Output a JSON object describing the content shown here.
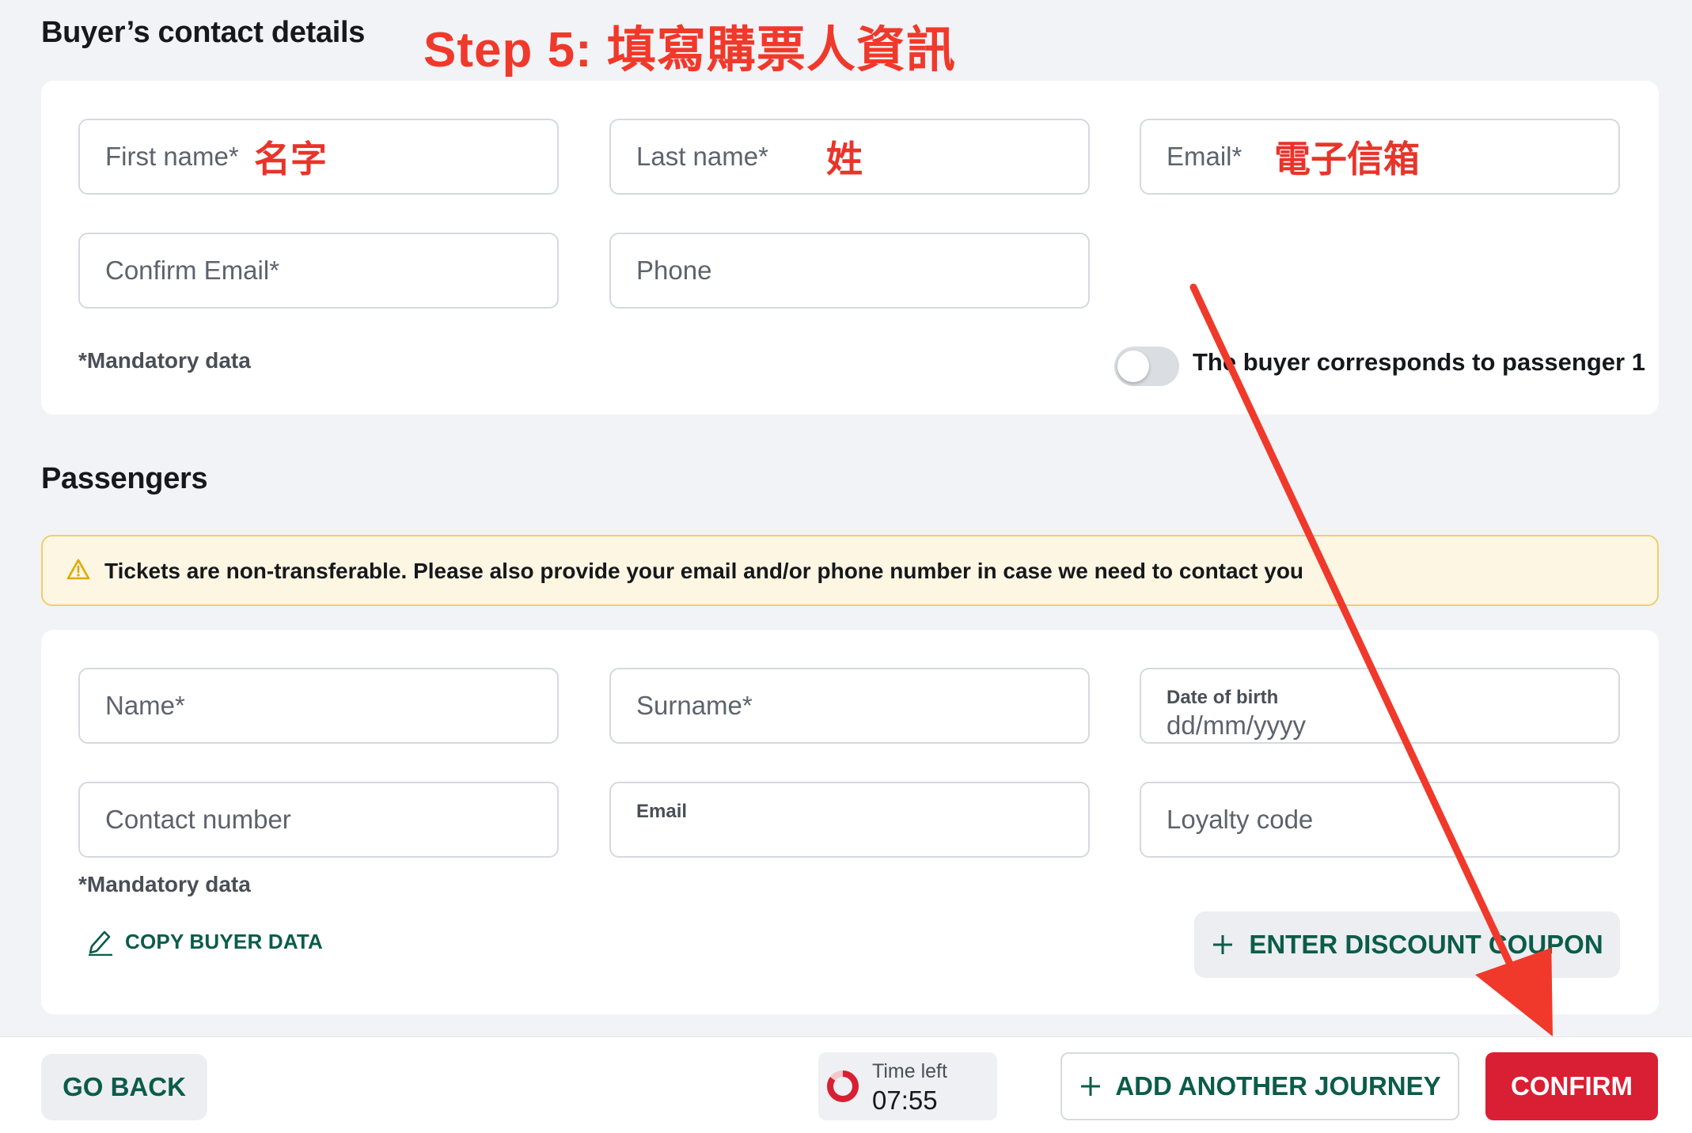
{
  "buyer": {
    "title": "Buyer’s contact details",
    "fields": {
      "first_name": "First name*",
      "last_name": "Last name*",
      "email": "Email*",
      "confirm_email": "Confirm Email*",
      "phone": "Phone"
    },
    "mandatory_note": "*Mandatory data",
    "toggle_label": "The buyer corresponds to passenger 1",
    "toggle_on": false
  },
  "annotations": {
    "step": "Step 5: 填寫購票人資訊",
    "first_name": "名字",
    "last_name": "姓",
    "email": "電子信箱",
    "arrow_color": "#f0392b"
  },
  "passengers": {
    "title": "Passengers",
    "warning": "Tickets are non-transferable. Please also provide your email and/or phone number in case we need to contact you",
    "fields": {
      "name": "Name*",
      "surname": "Surname*",
      "dob_label": "Date of birth",
      "dob_placeholder": "dd/mm/yyyy",
      "contact_number": "Contact number",
      "email_label": "Email",
      "loyalty_code": "Loyalty code"
    },
    "mandatory_note": "*Mandatory data",
    "copy_buyer": "COPY BUYER DATA",
    "discount": "ENTER DISCOUNT COUPON"
  },
  "footer": {
    "go_back": "GO BACK",
    "time_left_label": "Time left",
    "time_left_value": "07:55",
    "time_progress": 0.85,
    "add_journey": "ADD ANOTHER JOURNEY",
    "confirm": "CONFIRM"
  },
  "colors": {
    "accent_green": "#0b5c4a",
    "confirm_red": "#d81f33",
    "annotation_red": "#e8342a"
  }
}
